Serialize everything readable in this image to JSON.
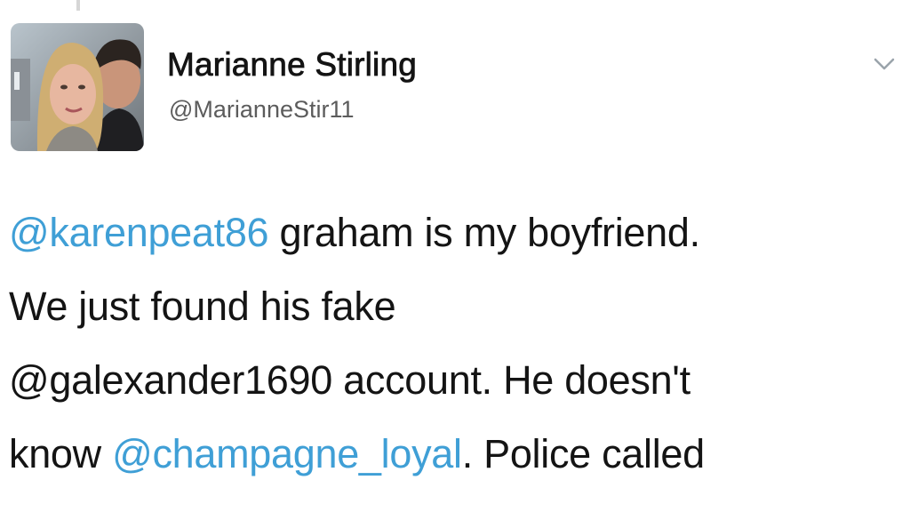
{
  "author": {
    "display_name": "Marianne Stirling",
    "handle": "@MarianneStir11",
    "avatar_icon": "profile-photo"
  },
  "menu": {
    "icon": "chevron-down-icon"
  },
  "tweet_text": {
    "line1": {
      "mention": "@karenpeat86",
      "text": " graham is my boyfriend."
    },
    "line2": {
      "text": "We just found his fake"
    },
    "line3": {
      "text": "@galexander1690 account. He doesn't"
    },
    "line4": {
      "pre": "know ",
      "mention": "@champagne_loyal",
      "text": ". Police called"
    }
  },
  "colors": {
    "mention": "#3f9fd6",
    "text": "#141414",
    "handle": "#5c5c5c"
  }
}
